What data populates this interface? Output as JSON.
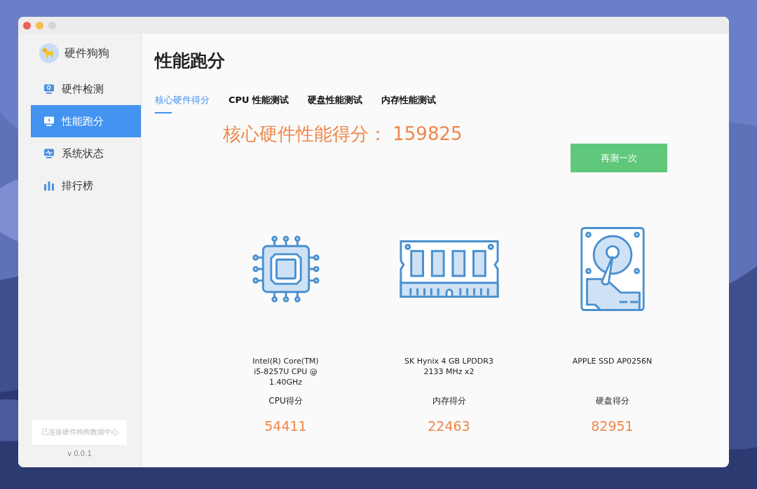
{
  "app": {
    "name": "硬件狗狗",
    "version": "v 0.0.1",
    "connection": "已连接硬件狗狗数据中心"
  },
  "sidebar": {
    "items": [
      {
        "label": "硬件检测",
        "kind": "detect",
        "selected": false
      },
      {
        "label": "性能跑分",
        "kind": "bench",
        "selected": true
      },
      {
        "label": "系统状态",
        "kind": "status",
        "selected": false
      },
      {
        "label": "排行榜",
        "kind": "rank",
        "selected": false
      }
    ]
  },
  "page": {
    "title": "性能跑分"
  },
  "tabs": [
    {
      "label": "核心硬件得分",
      "selected": true
    },
    {
      "label": "CPU 性能测试",
      "selected": false
    },
    {
      "label": "硬盘性能测试",
      "selected": false
    },
    {
      "label": "内存性能测试",
      "selected": false
    }
  ],
  "total_score": "核心硬件性能得分：  159825",
  "retry_button": "再测一次",
  "components": [
    {
      "kind": "cpu",
      "name": "Intel(R) Core(TM) i5-8257U CPU @ 1.40GHz",
      "label": "CPU得分",
      "score": "54411"
    },
    {
      "kind": "ram",
      "name": "SK Hynix 4 GB LPDDR3 2133 MHz x2",
      "label": "内存得分",
      "score": "22463"
    },
    {
      "kind": "disk",
      "name": "APPLE SSD AP0256N",
      "label": "硬盘得分",
      "score": "82951"
    }
  ]
}
